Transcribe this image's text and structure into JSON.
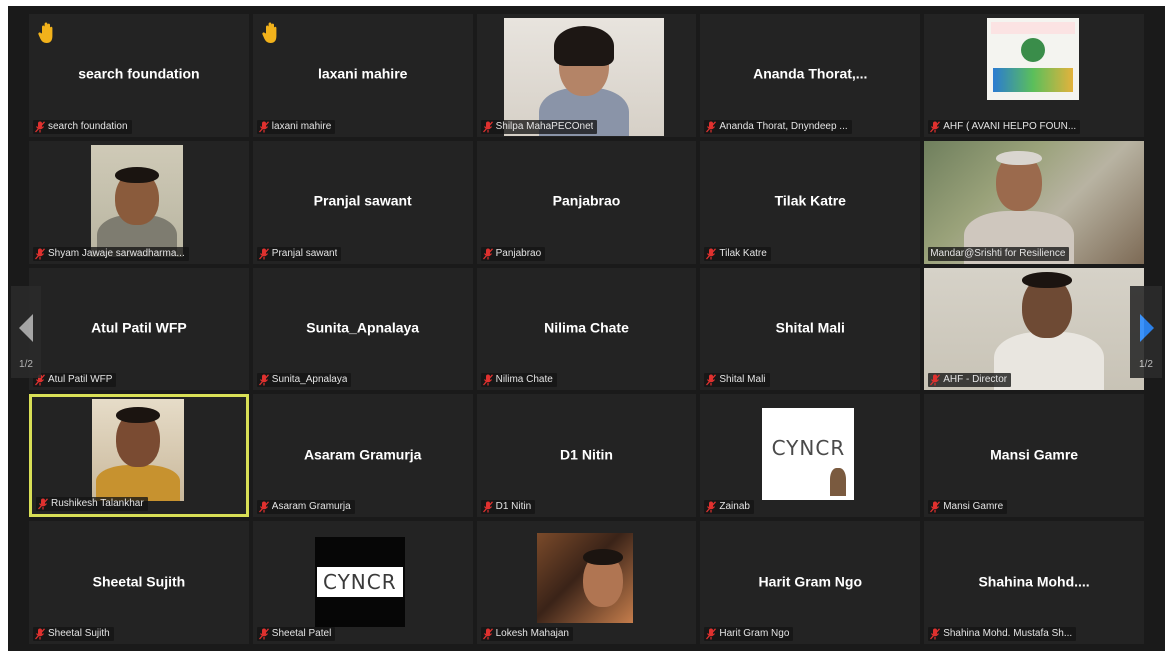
{
  "theme": {
    "background": "#1a1a1a",
    "tile": "#232323",
    "active_speaker_border": "#d8df56",
    "muted_red": "#e0312f",
    "hand_yellow": "#f2b21b",
    "nav_arrow_blue": "#2d8cff"
  },
  "pagination": {
    "left_label": "1/2",
    "right_label": "1/2"
  },
  "participants": [
    {
      "display": "search foundation",
      "tag": "search foundation",
      "hand": true,
      "muted": true
    },
    {
      "display": "laxani mahire",
      "tag": "laxani mahire",
      "hand": true,
      "muted": true
    },
    {
      "display": "",
      "tag": "Shilpa MahaPECOnet",
      "muted": true,
      "video": "cam-girl"
    },
    {
      "display": "Ananda  Thorat,...",
      "tag": "Ananda Thorat, Dnyndeep ...",
      "muted": true
    },
    {
      "display": "",
      "tag": "AHF ( AVANI HELPO FOUN...",
      "muted": true,
      "video": "logo-ahf"
    },
    {
      "display": "",
      "tag": "Shyam Jawaje sarwadharma...",
      "muted": true,
      "video": "cam-man1"
    },
    {
      "display": "Pranjal sawant",
      "tag": "Pranjal sawant",
      "muted": true
    },
    {
      "display": "Panjabrao",
      "tag": "Panjabrao",
      "muted": true
    },
    {
      "display": "Tilak Katre",
      "tag": "Tilak Katre",
      "muted": true
    },
    {
      "display": "",
      "tag": "Mandar@Srishti for Resilience",
      "muted": false,
      "video": "cam-old"
    },
    {
      "display": "Atul Patil WFP",
      "tag": "Atul Patil WFP",
      "muted": true
    },
    {
      "display": "Sunita_Apnalaya",
      "tag": "Sunita_Apnalaya",
      "muted": true
    },
    {
      "display": "Nilima Chate",
      "tag": "Nilima Chate",
      "muted": true
    },
    {
      "display": "Shital Mali",
      "tag": "Shital Mali",
      "muted": true
    },
    {
      "display": "",
      "tag": "AHF - Director",
      "muted": true,
      "video": "cam-director"
    },
    {
      "display": "",
      "tag": "Rushikesh Talankhar",
      "muted": true,
      "video": "cam-rushi",
      "active": true
    },
    {
      "display": "Asaram Gramurja",
      "tag": "Asaram Gramurja",
      "muted": true
    },
    {
      "display": "D1 Nitin",
      "tag": "D1 Nitin",
      "muted": true
    },
    {
      "display": "",
      "tag": "Zainab",
      "muted": true,
      "video": "logo-cyncr-white",
      "logo_text": "CYNCR"
    },
    {
      "display": "Mansi Gamre",
      "tag": "Mansi Gamre",
      "muted": true
    },
    {
      "display": "Sheetal Sujith",
      "tag": "Sheetal Sujith",
      "muted": true
    },
    {
      "display": "",
      "tag": "Sheetal Patel",
      "muted": true,
      "video": "logo-cyncr-black",
      "logo_text": "CYNCR"
    },
    {
      "display": "",
      "tag": "Lokesh Mahajan",
      "muted": true,
      "video": "cam-lokesh"
    },
    {
      "display": "Harit Gram Ngo",
      "tag": "Harit Gram Ngo",
      "muted": true
    },
    {
      "display": "Shahina  Mohd....",
      "tag": "Shahina Mohd. Mustafa Sh...",
      "muted": true
    }
  ]
}
